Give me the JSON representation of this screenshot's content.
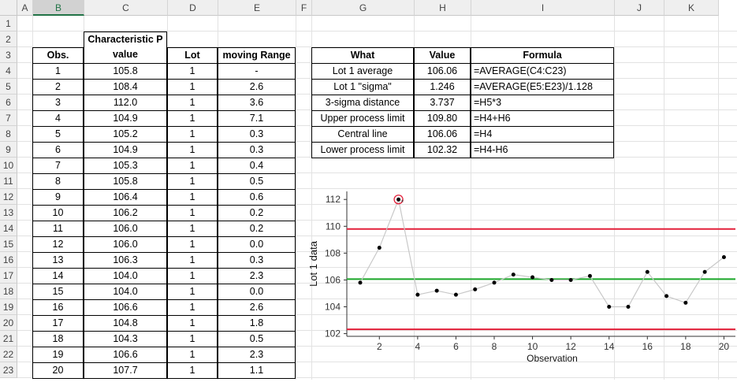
{
  "column_headers": [
    "A",
    "B",
    "C",
    "D",
    "E",
    "F",
    "G",
    "H",
    "I",
    "J",
    "K"
  ],
  "row_numbers": [
    "1",
    "2",
    "3",
    "4",
    "5",
    "6",
    "7",
    "8",
    "9",
    "10",
    "11",
    "12",
    "13",
    "14",
    "15",
    "16",
    "17",
    "18",
    "19",
    "20",
    "21",
    "22",
    "23"
  ],
  "data_table": {
    "headers": {
      "obs": "Obs.",
      "char_line1": "Characteristic P",
      "char_line2": "value",
      "lot": "Lot",
      "moving_range": "moving Range"
    },
    "rows": [
      [
        "1",
        "105.8",
        "1",
        "-"
      ],
      [
        "2",
        "108.4",
        "1",
        "2.6"
      ],
      [
        "3",
        "112.0",
        "1",
        "3.6"
      ],
      [
        "4",
        "104.9",
        "1",
        "7.1"
      ],
      [
        "5",
        "105.2",
        "1",
        "0.3"
      ],
      [
        "6",
        "104.9",
        "1",
        "0.3"
      ],
      [
        "7",
        "105.3",
        "1",
        "0.4"
      ],
      [
        "8",
        "105.8",
        "1",
        "0.5"
      ],
      [
        "9",
        "106.4",
        "1",
        "0.6"
      ],
      [
        "10",
        "106.2",
        "1",
        "0.2"
      ],
      [
        "11",
        "106.0",
        "1",
        "0.2"
      ],
      [
        "12",
        "106.0",
        "1",
        "0.0"
      ],
      [
        "13",
        "106.3",
        "1",
        "0.3"
      ],
      [
        "14",
        "104.0",
        "1",
        "2.3"
      ],
      [
        "15",
        "104.0",
        "1",
        "0.0"
      ],
      [
        "16",
        "106.6",
        "1",
        "2.6"
      ],
      [
        "17",
        "104.8",
        "1",
        "1.8"
      ],
      [
        "18",
        "104.3",
        "1",
        "0.5"
      ],
      [
        "19",
        "106.6",
        "1",
        "2.3"
      ],
      [
        "20",
        "107.7",
        "1",
        "1.1"
      ]
    ]
  },
  "summary_table": {
    "headers": {
      "what": "What",
      "value": "Value",
      "formula": "Formula"
    },
    "rows": [
      [
        "Lot 1 average",
        "106.06",
        "=AVERAGE(C4:C23)"
      ],
      [
        "Lot 1 \"sigma\"",
        "1.246",
        "=AVERAGE(E5:E23)/1.128"
      ],
      [
        "3-sigma distance",
        "3.737",
        "=H5*3"
      ],
      [
        "Upper process limit",
        "109.80",
        "=H4+H6"
      ],
      [
        "Central line",
        "106.06",
        "=H4"
      ],
      [
        "Lower process limit",
        "102.32",
        "=H4-H6"
      ]
    ]
  },
  "chart_data": {
    "type": "line",
    "xlabel": "Observation",
    "ylabel": "Lot 1 data",
    "x": [
      1,
      2,
      3,
      4,
      5,
      6,
      7,
      8,
      9,
      10,
      11,
      12,
      13,
      14,
      15,
      16,
      17,
      18,
      19,
      20
    ],
    "values": [
      105.8,
      108.4,
      112.0,
      104.9,
      105.2,
      104.9,
      105.3,
      105.8,
      106.4,
      106.2,
      106.0,
      106.0,
      106.3,
      104.0,
      104.0,
      106.6,
      104.8,
      104.3,
      106.6,
      107.7
    ],
    "xlim": [
      0.3,
      20.6
    ],
    "ylim": [
      101.8,
      112.6
    ],
    "xticks": [
      2,
      4,
      6,
      8,
      10,
      12,
      14,
      16,
      18,
      20
    ],
    "yticks": [
      102,
      104,
      106,
      108,
      110,
      112
    ],
    "reference_lines": [
      {
        "value": 109.8,
        "color": "#e3203a"
      },
      {
        "value": 106.06,
        "color": "#1aa628"
      },
      {
        "value": 102.32,
        "color": "#e3203a"
      }
    ],
    "highlighted_point": 3,
    "highlight_mark": "*",
    "line_color": "#c8c8c8",
    "point_color": "#000000",
    "grid": false
  }
}
